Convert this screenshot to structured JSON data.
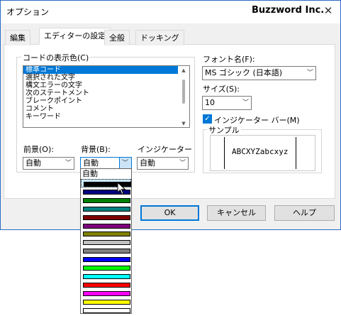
{
  "window": {
    "title": "オプション",
    "brand": "Buzzword Inc.",
    "close_glyph": "✕"
  },
  "tabs": [
    {
      "label": "編集",
      "active": false
    },
    {
      "label": "エディターの設定",
      "active": true
    },
    {
      "label": "全般",
      "active": false
    },
    {
      "label": "ドッキング",
      "active": false
    }
  ],
  "code_color_group": {
    "label": "コードの表示色(C)",
    "items": [
      "標準コード",
      "選択された文字",
      "構文エラーの文字",
      "次のステートメント",
      "ブレークポイント",
      "コメント",
      "キーワード"
    ],
    "selected_index": 0
  },
  "foreground": {
    "label": "前景(O):",
    "value": "自動"
  },
  "background": {
    "label": "背景(B):",
    "value": "自動"
  },
  "indicator": {
    "label": "インジケーター",
    "value": "自動"
  },
  "font": {
    "label": "フォント名(F):",
    "value": "MS ゴシック (日本語)"
  },
  "size": {
    "label": "サイズ(S):",
    "value": "10"
  },
  "indicator_bar": {
    "label": "インジケーター バー(M)",
    "checked": true,
    "check_glyph": "✓"
  },
  "sample": {
    "label": "サンプル",
    "text": "ABCXYZabcxyz"
  },
  "buttons": {
    "ok": "OK",
    "cancel": "キャンセル",
    "help": "ヘルプ"
  },
  "dropdown": {
    "auto_label": "自動",
    "swatches": [
      "#000000",
      "#000080",
      "#008000",
      "#008080",
      "#800000",
      "#800080",
      "#808000",
      "#c0c0c0",
      "#808080",
      "#0000ff",
      "#00ff00",
      "#00ffff",
      "#ff0000",
      "#ff00ff",
      "#ffff00",
      "#ffffff"
    ],
    "highlighted_index": 0
  },
  "icons": {
    "chevron": "﹀",
    "scroll_up": "▲",
    "scroll_down": "▼"
  }
}
